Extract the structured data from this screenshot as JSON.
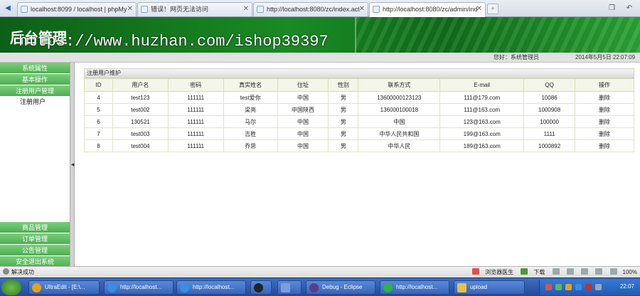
{
  "browser": {
    "tabs": [
      {
        "label": "localhost:8099 / localhost | phpMy"
      },
      {
        "label": "错误！网页无法访问"
      },
      {
        "label": "http://localhost:8080/zc/index.act"
      },
      {
        "label": "http://localhost:8080/zc/admin/ind"
      }
    ],
    "add_tab": "+"
  },
  "header": {
    "title": "后台管理",
    "watermark": "https://www.huzhan.com/ishop39397"
  },
  "welcome": {
    "greeting": "您好：系统管理员",
    "date": "2014年5月5日 22:07:09"
  },
  "sidebar": {
    "top_menus": [
      {
        "label": "系统属性"
      },
      {
        "label": "基本操作"
      },
      {
        "label": "注册用户管理"
      }
    ],
    "sub_item": "注册用户",
    "bottom_menus": [
      {
        "label": "商品管理"
      },
      {
        "label": "订单管理"
      },
      {
        "label": "公告管理"
      },
      {
        "label": "安全退出系统"
      }
    ]
  },
  "main": {
    "breadcrumb": "注册用户维护",
    "columns": [
      "ID",
      "用户名",
      "密码",
      "真实姓名",
      "住址",
      "性别",
      "联系方式",
      "E-mail",
      "QQ",
      "操作"
    ],
    "rows": [
      [
        "4",
        "test123",
        "111111",
        "test爱你",
        "中国",
        "男",
        "13600000123123",
        "111@179.com",
        "10086",
        "删除"
      ],
      [
        "5",
        "test002",
        "111111",
        "梁亮",
        "中国陕西",
        "男",
        "136000100018",
        "111@163.com",
        "1000908",
        "删除"
      ],
      [
        "6",
        "130521",
        "111111",
        "马尔",
        "中国",
        "男",
        "中国",
        "123@163.com",
        "100000",
        "删除"
      ],
      [
        "7",
        "test003",
        "111111",
        "吉胜",
        "中国",
        "男",
        "中华人民共和国",
        "199@163.com",
        "1111",
        "删除"
      ],
      [
        "8",
        "test004",
        "111111",
        "乔思",
        "中国",
        "男",
        "中华人民",
        "189@163.com",
        "1000892",
        "删除"
      ]
    ]
  },
  "statusbar": {
    "status": "解决成功",
    "browser_doctor": "浏览器医生",
    "download": "下载",
    "zoom": "100%"
  },
  "taskbar": {
    "tasks": [
      {
        "label": "UltraEdit - [E:\\..."
      },
      {
        "label": "http://localhost..."
      },
      {
        "label": "http://localhost..."
      },
      {
        "label": ""
      },
      {
        "label": ""
      },
      {
        "label": "Debug - Eclipse"
      },
      {
        "label": "http://localhost..."
      },
      {
        "label": "upload"
      }
    ],
    "clock": "22:07"
  }
}
